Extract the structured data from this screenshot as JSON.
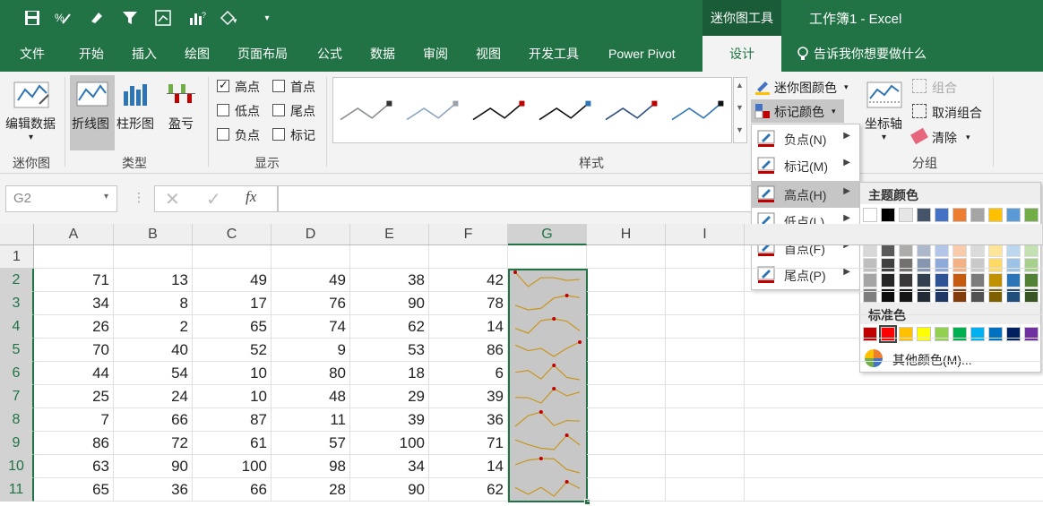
{
  "qat": {
    "save": "save-icon",
    "undo": "undo-format-icon",
    "brush": "format-painter-icon",
    "filter": "filter-icon",
    "pivot": "pivot-icon",
    "chart": "chart-icon",
    "shape": "shape-icon",
    "more": "▾"
  },
  "context_tab": "迷你图工具",
  "window_title": "工作簿1  -  Excel",
  "tabs": [
    "文件",
    "开始",
    "插入",
    "绘图",
    "页面布局",
    "公式",
    "数据",
    "审阅",
    "视图",
    "开发工具",
    "Power Pivot",
    "设计"
  ],
  "tellme": "告诉我你想要做什么",
  "ribbon": {
    "edit_data": "编辑数据",
    "sparkline_group": "迷你图",
    "line": "折线图",
    "column": "柱形图",
    "winloss": "盈亏",
    "type_group": "类型",
    "show_group": "显示",
    "checks": [
      {
        "label": "高点",
        "checked": true
      },
      {
        "label": "首点",
        "checked": false
      },
      {
        "label": "低点",
        "checked": false
      },
      {
        "label": "尾点",
        "checked": false
      },
      {
        "label": "负点",
        "checked": false
      },
      {
        "label": "标记",
        "checked": false
      }
    ],
    "style_group": "样式",
    "sparkline_color": "迷你图颜色",
    "marker_color": "标记颜色",
    "axis": "坐标轴",
    "group_btn": "组合",
    "ungroup": "取消组合",
    "clear": "清除",
    "group_group": "分组"
  },
  "styles": [
    {
      "line": "#8a8f96",
      "marker": "#333333"
    },
    {
      "line": "#8fa6c0",
      "marker": "#9aa1a8"
    },
    {
      "line": "#111111",
      "marker": "#c00000"
    },
    {
      "line": "#111111",
      "marker": "#2e75b6"
    },
    {
      "line": "#2e4e7e",
      "marker": "#c00000"
    },
    {
      "line": "#2e75b6",
      "marker": "#111111"
    }
  ],
  "namebox": "G2",
  "fx": "fx",
  "columns": [
    "A",
    "B",
    "C",
    "D",
    "E",
    "F",
    "G",
    "H",
    "I"
  ],
  "rows": [
    "1",
    "2",
    "3",
    "4",
    "5",
    "6",
    "7",
    "8",
    "9",
    "10",
    "11"
  ],
  "data": [
    [
      71,
      13,
      49,
      49,
      38,
      42
    ],
    [
      34,
      8,
      17,
      76,
      90,
      78
    ],
    [
      26,
      2,
      65,
      74,
      62,
      14
    ],
    [
      70,
      40,
      52,
      9,
      53,
      86
    ],
    [
      44,
      54,
      10,
      80,
      18,
      6
    ],
    [
      25,
      24,
      10,
      48,
      29,
      39
    ],
    [
      7,
      66,
      87,
      11,
      39,
      36
    ],
    [
      86,
      72,
      61,
      57,
      100,
      71
    ],
    [
      63,
      90,
      100,
      98,
      34,
      14
    ],
    [
      65,
      36,
      66,
      28,
      90,
      62
    ]
  ],
  "sparkline": {
    "line_color": "#c8961e",
    "marker_color": "#c00000",
    "bg": "#c7c7c7"
  },
  "marker_menu": [
    "负点(N)",
    "标记(M)",
    "高点(H)",
    "低点(L)",
    "首点(F)",
    "尾点(P)"
  ],
  "marker_menu_selected": 2,
  "palette": {
    "theme_title": "主题颜色",
    "theme_top": [
      "#ffffff",
      "#000000",
      "#e7e6e6",
      "#44546a",
      "#4472c4",
      "#ed7d31",
      "#a5a5a5",
      "#ffc000",
      "#5b9bd5",
      "#70ad47"
    ],
    "theme_shades": [
      [
        "#f2f2f2",
        "#7f7f7f",
        "#d0cece",
        "#d6dce4",
        "#d9e2f3",
        "#fbe5d5",
        "#ededed",
        "#fff2cc",
        "#deebf6",
        "#e2efd9"
      ],
      [
        "#d8d8d8",
        "#595959",
        "#aeabab",
        "#adb9ca",
        "#b4c6e7",
        "#f7cbac",
        "#dbdbdb",
        "#fee599",
        "#bdd7ee",
        "#c5e0b3"
      ],
      [
        "#bfbfbf",
        "#3f3f3f",
        "#757070",
        "#8496b0",
        "#8eaadb",
        "#f4b183",
        "#c9c9c9",
        "#ffd965",
        "#9cc3e5",
        "#a8d08d"
      ],
      [
        "#a5a5a5",
        "#262626",
        "#3a3838",
        "#323f4f",
        "#2f5496",
        "#c55a11",
        "#7b7b7b",
        "#bf9000",
        "#2e75b5",
        "#538135"
      ],
      [
        "#7f7f7f",
        "#0c0c0c",
        "#171616",
        "#222a35",
        "#1f3864",
        "#833c0b",
        "#525252",
        "#7f6000",
        "#1e4e79",
        "#375623"
      ]
    ],
    "standard_title": "标准色",
    "standard": [
      "#c00000",
      "#ff0000",
      "#ffc000",
      "#ffff00",
      "#92d050",
      "#00b050",
      "#00b0f0",
      "#0070c0",
      "#002060",
      "#7030a0"
    ],
    "standard_selected": 1,
    "more": "其他颜色(M)..."
  }
}
